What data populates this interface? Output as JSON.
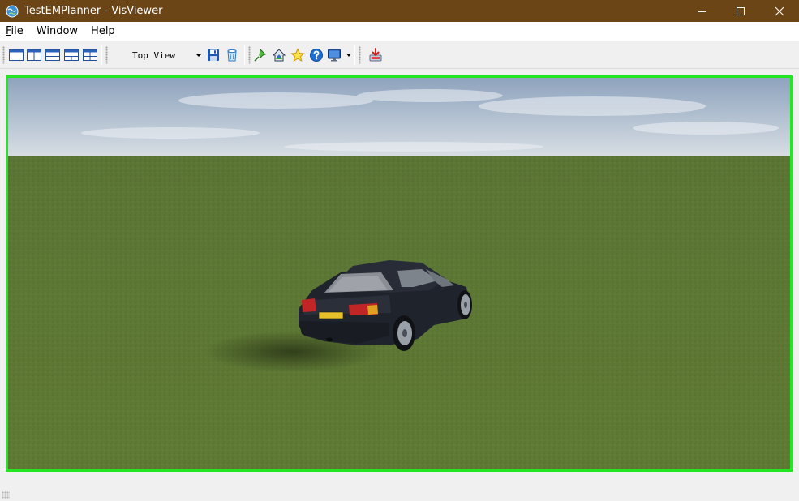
{
  "window": {
    "title": "TestEMPlanner - VisViewer",
    "app_icon": "globe-icon",
    "controls": [
      "minimize-icon",
      "maximize-icon",
      "close-icon"
    ]
  },
  "menu": {
    "file_mnemonic": "F",
    "file_rest": "ile",
    "window": "Window",
    "help": "Help"
  },
  "toolbar": {
    "layout_buttons": [
      "layout-single-icon",
      "layout-two-vertical-icon",
      "layout-two-horizontal-icon",
      "layout-three-icon",
      "layout-four-icon"
    ],
    "view_selected": "Top View",
    "buttons": [
      "save-icon",
      "clear-icon",
      "pin-icon",
      "home-view-icon",
      "star-icon",
      "help-icon",
      "monitor-icon",
      "download-icon"
    ]
  },
  "colors": {
    "titlebar": "#6b4515",
    "viewport_border": "#22e622",
    "grass": "#5f7a35",
    "car_body": "#1f232c"
  },
  "scene": {
    "license_plate": "passenger"
  }
}
